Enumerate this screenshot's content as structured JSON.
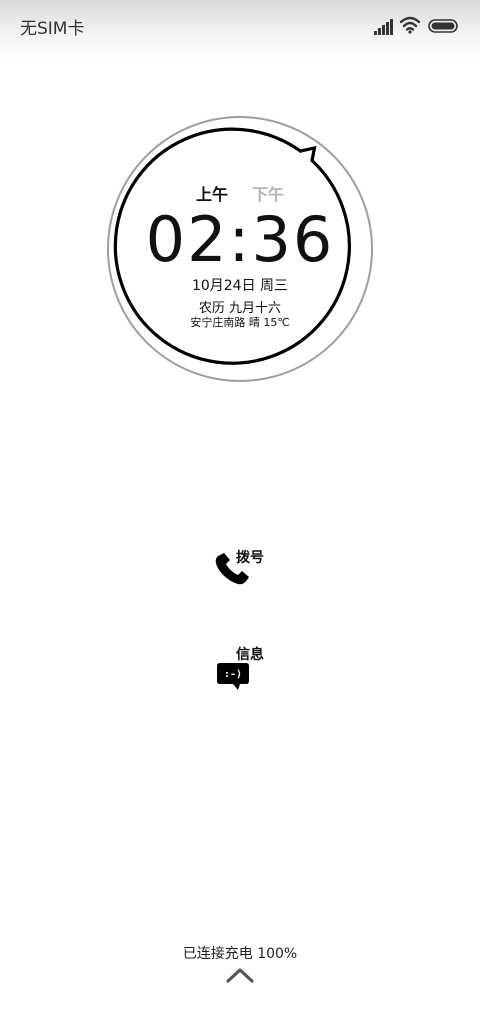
{
  "status_bar": {
    "carrier": "无SIM卡",
    "icons": [
      "signal-icon",
      "wifi-icon",
      "battery-icon"
    ],
    "battery_level": 1.0
  },
  "clock": {
    "am_label": "上午",
    "pm_label": "下午",
    "active_period": "am",
    "time": "02:36",
    "date": "10月24日 周三",
    "lunar": "农历 九月十六",
    "weather": "安宁庄南路 晴 15℃"
  },
  "shortcuts": {
    "dial": {
      "label": "拨号",
      "icon": "phone-icon"
    },
    "message": {
      "label": "信息",
      "icon": "message-icon",
      "icon_text": ":-)"
    }
  },
  "footer": {
    "charging": "已连接充电 100%",
    "unlock_icon": "chevron-up-icon"
  },
  "colors": {
    "ring_outer": "#9e9e9e",
    "ring_inner": "#000000",
    "inactive_text": "#b3b3b3"
  }
}
